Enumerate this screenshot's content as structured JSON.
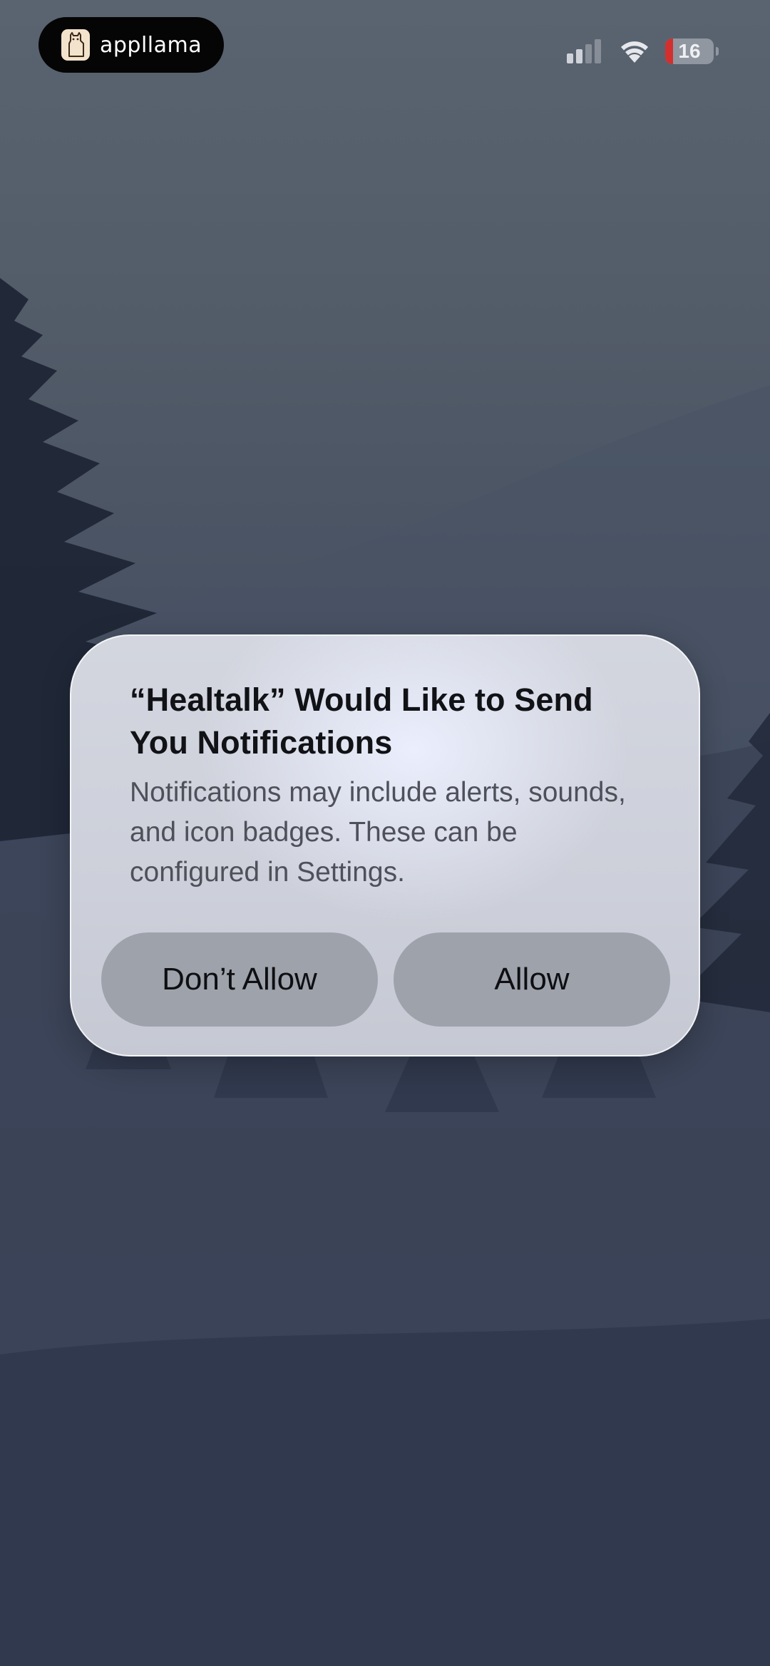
{
  "status_bar": {
    "app_badge": {
      "name": "appllama",
      "icon": "llama-icon"
    },
    "signal_bars_active": 2,
    "signal_bars_total": 4,
    "battery_level": "16",
    "battery_color": "#d32f2f"
  },
  "alert": {
    "title": "“Healtalk” Would Like to Send You Notifications",
    "message": "Notifications may include alerts, sounds, and icon badges. These can be configured in Settings.",
    "buttons": {
      "deny_label": "Don’t Allow",
      "allow_label": "Allow"
    }
  }
}
